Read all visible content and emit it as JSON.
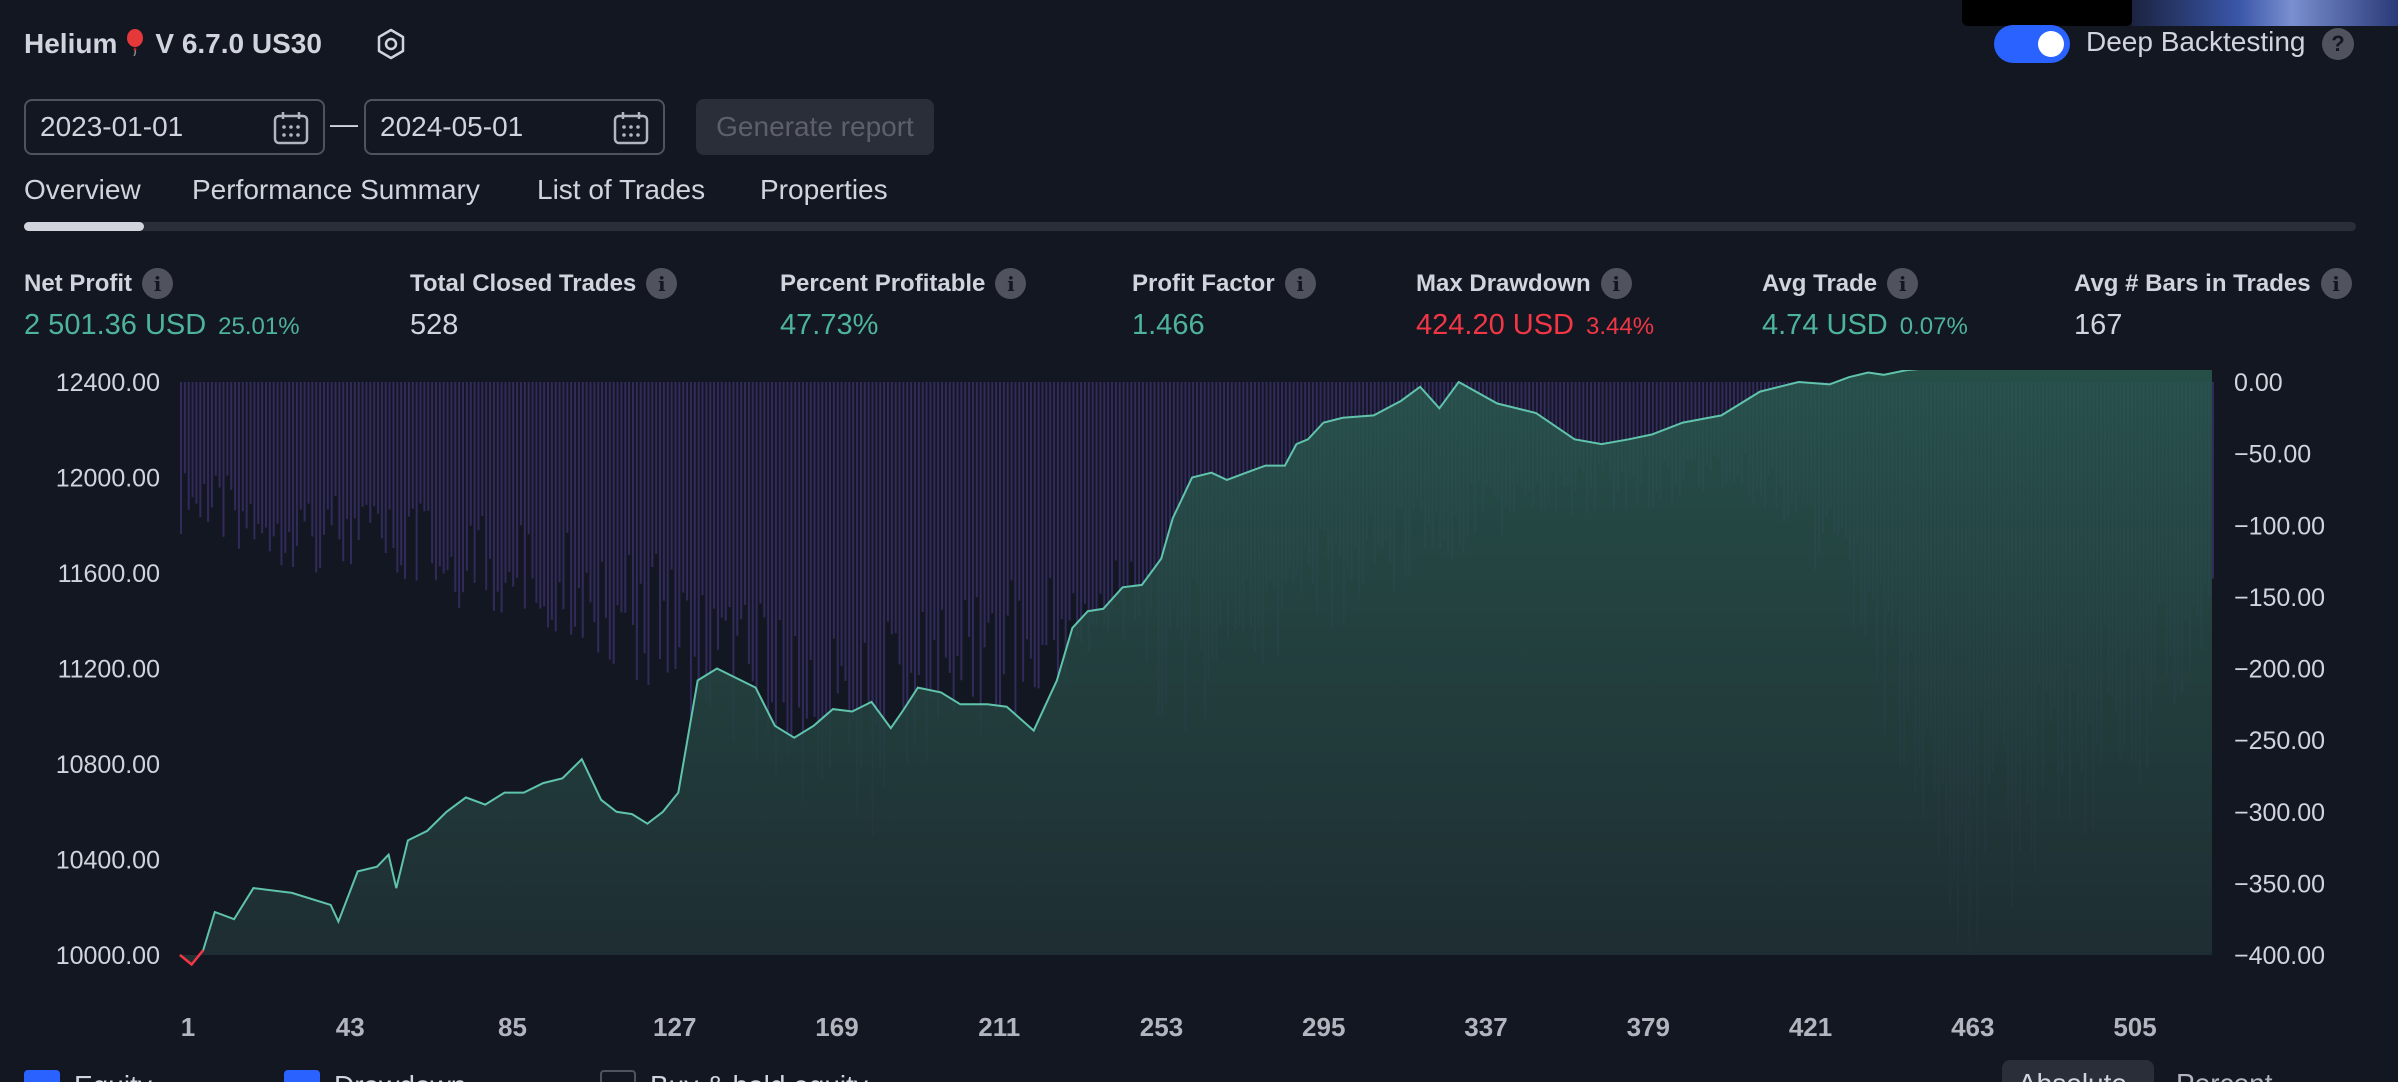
{
  "header": {
    "app_name": "Helium",
    "version_symbol": "V 6.7.0 US30",
    "deep_backtesting_label": "Deep Backtesting",
    "deep_backtesting_on": true,
    "help_glyph": "?"
  },
  "date_range": {
    "start": "2023-01-01",
    "end": "2024-05-01",
    "separator": "—",
    "generate_button": "Generate report"
  },
  "tabs": [
    {
      "label": "Overview",
      "active": true
    },
    {
      "label": "Performance Summary",
      "active": false
    },
    {
      "label": "List of Trades",
      "active": false
    },
    {
      "label": "Properties",
      "active": false
    }
  ],
  "metrics": {
    "net_profit": {
      "label": "Net Profit",
      "value": "2 501.36 USD",
      "sub": "25.01%"
    },
    "total_closed_trades": {
      "label": "Total Closed Trades",
      "value": "528"
    },
    "percent_profitable": {
      "label": "Percent Profitable",
      "value": "47.73%"
    },
    "profit_factor": {
      "label": "Profit Factor",
      "value": "1.466"
    },
    "max_drawdown": {
      "label": "Max Drawdown",
      "value": "424.20 USD",
      "sub": "3.44%"
    },
    "avg_trade": {
      "label": "Avg Trade",
      "value": "4.74 USD",
      "sub": "0.07%"
    },
    "avg_bars": {
      "label": "Avg # Bars in Trades",
      "value": "167"
    }
  },
  "info_glyph": "i",
  "chart_data": {
    "type": "area",
    "left_ticks": [
      "12400.00",
      "12000.00",
      "11600.00",
      "11200.00",
      "10800.00",
      "10400.00",
      "10000.00"
    ],
    "right_ticks": [
      "0.00",
      "−50.00",
      "−100.00",
      "−150.00",
      "−200.00",
      "−250.00",
      "−300.00",
      "−350.00",
      "−400.00"
    ],
    "x_ticks": [
      "1",
      "43",
      "85",
      "127",
      "169",
      "211",
      "253",
      "295",
      "337",
      "379",
      "421",
      "463",
      "505"
    ],
    "ylim_left": [
      10000,
      12400
    ],
    "ylim_right": [
      -400,
      0
    ],
    "series": [
      {
        "name": "Equity",
        "x": [
          1,
          4,
          7,
          10,
          15,
          20,
          30,
          40,
          42,
          47,
          52,
          55,
          57,
          60,
          65,
          70,
          75,
          80,
          85,
          90,
          95,
          100,
          105,
          110,
          114,
          118,
          122,
          126,
          130,
          135,
          140,
          150,
          155,
          160,
          165,
          170,
          175,
          180,
          185,
          188,
          192,
          198,
          203,
          210,
          215,
          222,
          228,
          232,
          236,
          240,
          245,
          250,
          255,
          258,
          263,
          268,
          272,
          277,
          282,
          287,
          290,
          293,
          297,
          302,
          310,
          317,
          322,
          327,
          332,
          342,
          352,
          362,
          369,
          376,
          382,
          390,
          400,
          410,
          420,
          428,
          433,
          438,
          442,
          448,
          455,
          462,
          468,
          472,
          477,
          483,
          488,
          495,
          500,
          508,
          515,
          520,
          525,
          527
        ],
        "values": [
          10000,
          9960,
          10020,
          10180,
          10150,
          10280,
          10260,
          10210,
          10140,
          10350,
          10370,
          10420,
          10280,
          10480,
          10520,
          10600,
          10660,
          10630,
          10680,
          10680,
          10720,
          10740,
          10820,
          10650,
          10600,
          10590,
          10550,
          10600,
          10680,
          11150,
          11200,
          11120,
          10960,
          10910,
          10960,
          11030,
          11020,
          11060,
          10950,
          11020,
          11120,
          11100,
          11050,
          11050,
          11040,
          10940,
          11150,
          11370,
          11440,
          11450,
          11540,
          11550,
          11660,
          11830,
          12000,
          12020,
          11990,
          12020,
          12050,
          12050,
          12140,
          12160,
          12230,
          12250,
          12260,
          12320,
          12380,
          12290,
          12400,
          12310,
          12270,
          12160,
          12140,
          12160,
          12180,
          12230,
          12260,
          12360,
          12400,
          12390,
          12420,
          12440,
          12430,
          12450,
          12460,
          12480,
          12500,
          12520,
          12500,
          12520,
          12490,
          12470,
          12470,
          12470,
          12480,
          12470,
          12480,
          12480
        ]
      },
      {
        "name": "Drawdown",
        "note": "bars hanging from 0.00 on the right axis",
        "x": [
          1,
          30,
          60,
          100,
          120,
          140,
          160,
          175,
          180,
          190,
          200,
          220,
          240,
          260,
          280,
          300,
          320,
          340,
          360,
          380,
          400,
          420,
          440,
          450,
          460,
          465,
          470,
          480,
          490,
          500,
          510,
          520,
          527
        ],
        "values": [
          -110,
          -130,
          -150,
          -180,
          -210,
          -250,
          -300,
          -330,
          -320,
          -280,
          -250,
          -250,
          -200,
          -250,
          -210,
          -180,
          -140,
          -120,
          -100,
          -90,
          -80,
          -110,
          -230,
          -330,
          -400,
          -415,
          -400,
          -380,
          -340,
          -300,
          -280,
          -220,
          -200
        ]
      }
    ]
  },
  "legend": {
    "items": [
      "Equity",
      "Drawdown",
      "Buy & hold equity"
    ],
    "toggle": [
      "Absolute",
      "Percent"
    ]
  }
}
